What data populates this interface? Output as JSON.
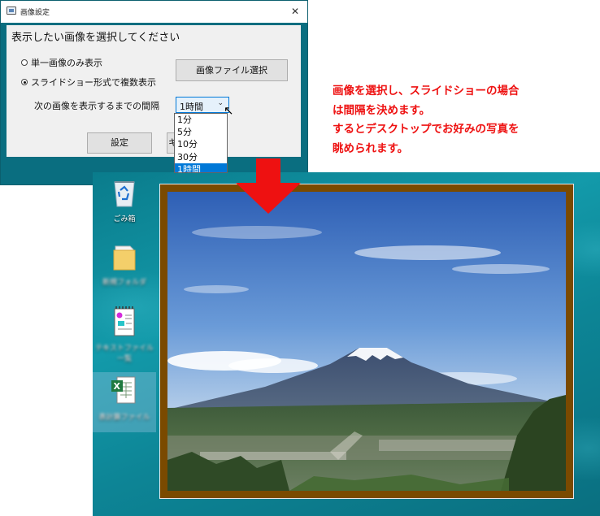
{
  "dialog": {
    "title": "画像設定",
    "close_glyph": "✕",
    "heading": "表示したい画像を選択してください",
    "radio_single_label": "単一画像のみ表示",
    "radio_slideshow_label": "スライドショー形式で複数表示",
    "slideshow_selected": true,
    "file_button_label": "画像ファイル選択",
    "interval_label": "次の画像を表示するまでの間隔",
    "interval_value": "1時間",
    "interval_options": [
      "1分",
      "5分",
      "10分",
      "30分",
      "1時間"
    ],
    "set_button_label": "設定",
    "cancel_button_label": "キ"
  },
  "note": {
    "lines": [
      "画像を選択し、スライドショーの場合",
      "は間隔を決めます。",
      "するとデスクトップでお好みの写真を",
      "眺められます。"
    ],
    "color": "#ee1111"
  },
  "desktop": {
    "icons": [
      {
        "name": "recycle-bin",
        "label": "ごみ箱"
      },
      {
        "name": "folder",
        "label": "新規フォルダ"
      },
      {
        "name": "notepad-file",
        "label": "テキストファイル一覧"
      },
      {
        "name": "excel-file",
        "label": "表計算ファイル"
      }
    ],
    "wallpaper_photo": "mount-fuji"
  },
  "colors": {
    "accent": "#0078d7",
    "frame": "#7a4a00",
    "arrow": "#ee1111",
    "desktop": "#0d8596"
  }
}
